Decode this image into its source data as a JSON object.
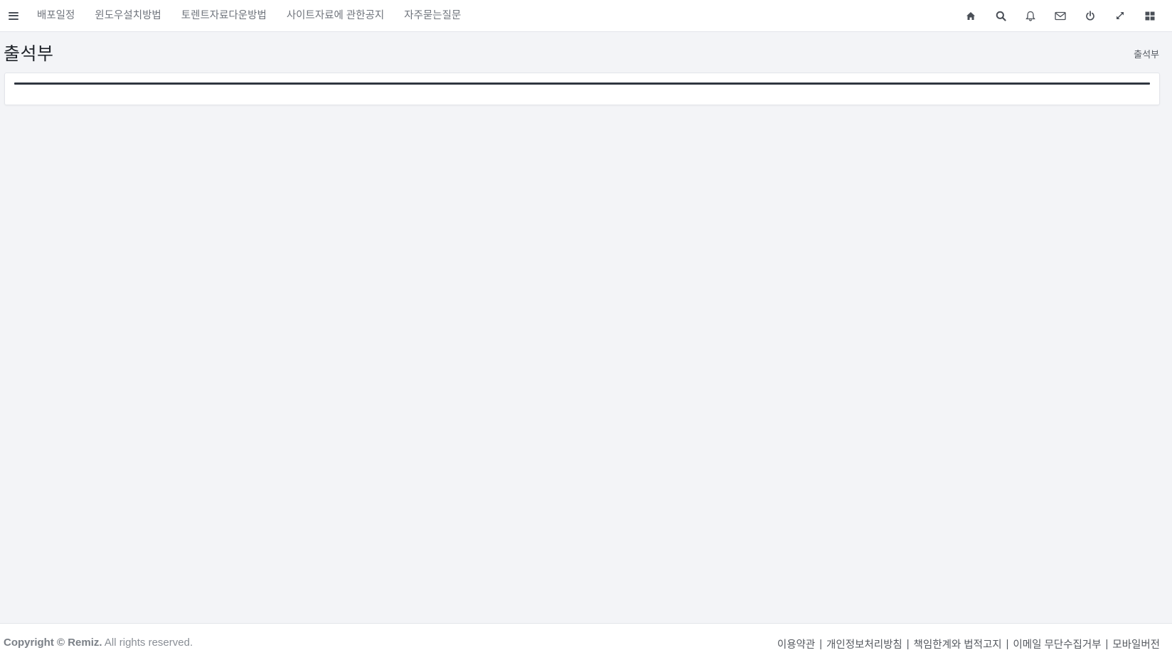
{
  "topbar": {
    "menu_icon": "hamburger-menu-icon",
    "nav_items": [
      {
        "label": "배포일정"
      },
      {
        "label": "윈도우설치방법"
      },
      {
        "label": "토렌트자료다운방법"
      },
      {
        "label": "사이트자료에 관한공지"
      },
      {
        "label": "자주묻는질문"
      }
    ],
    "icons": [
      "home-icon",
      "search-icon",
      "bell-icon",
      "envelope-icon",
      "power-icon",
      "expand-icon",
      "grid-icon"
    ],
    "icon_color": "#4a4f57"
  },
  "page": {
    "title": "출석부",
    "breadcrumb": "출석부"
  },
  "footer": {
    "copyright_prefix": "Copyright © Remiz.",
    "copyright_suffix": " All rights reserved.",
    "links": [
      {
        "label": "이용약관"
      },
      {
        "label": "개인정보처리방침"
      },
      {
        "label": "책임한계와 법적고지"
      },
      {
        "label": "이메일 무단수집거부"
      },
      {
        "label": "모바일버전"
      }
    ],
    "separator": "|"
  },
  "colors": {
    "page_background": "#f3f4f7",
    "surface": "#ffffff",
    "rule": "#2f3640"
  }
}
